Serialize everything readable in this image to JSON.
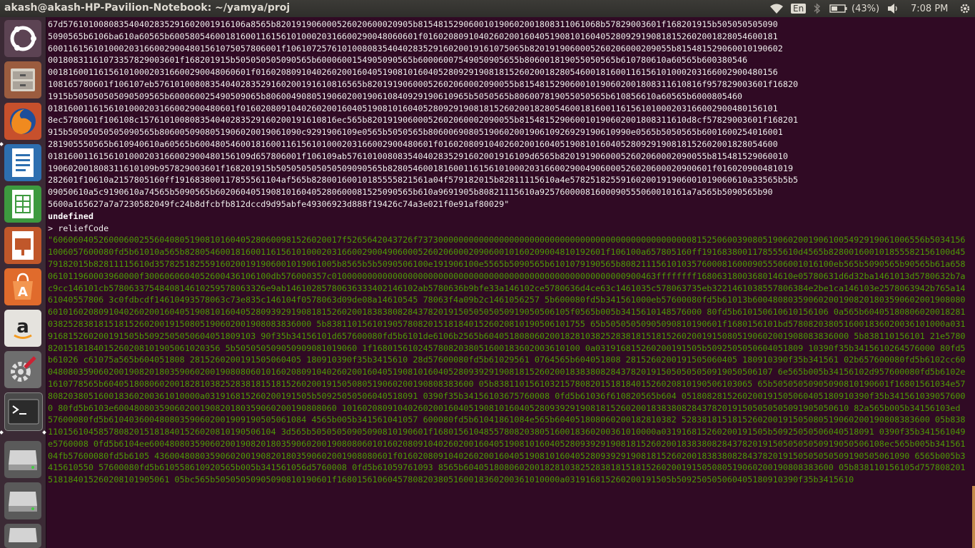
{
  "topbar": {
    "title": "akash@akash-HP-Pavilion-Notebook: ~/yamya/proj",
    "keyboard": "En",
    "battery": "(43%)",
    "time": "7:08 PM"
  },
  "launcher": {
    "icons": [
      "ubuntu-dash-icon",
      "files-icon",
      "firefox-icon",
      "writer-icon",
      "calc-icon",
      "impress-icon",
      "software-center-icon",
      "amazon-icon",
      "system-settings-icon",
      "terminal-icon",
      "drive-icon",
      "drive-icon",
      "drive-icon"
    ]
  },
  "terminal": {
    "hex_block": "67d576101008083540402835291602001916106a8565b820191906000526020600020905b815481529060010190602001808311061068b57829003601f168201915b505050505090\n5090565b6106ba610a60565b6005805460018160011615610100020316600290048060601f0160208091040260200160405190810160405280929190818152602001828054600181\n6001161561010002031660029004801561075057806001f10610725761010080835404028352916020019161075065b8201919060005260206000209055b815481529060010190602\n00180831161073357829003601f168201915b505050505090565b6000600154905090565b60006007549050905655b806001819055050565b610780610a60565b600380546\n0018160011615610100020316600290048060601f0160208091040260200160405190810160405280929190818152602001828054600181600116156101000203166002900480156\n108165780601f106107eb57610100808354040283529160200191610816565b82019190600052602060002090055b815481529060010190602001808311610816f957829003601f16820\n1915b505050505090509565b600060025490509065b8060049080519060200190610840929190610965b5050565b806007819055050565b610856610a60565b6000805460\n0181600116156101000203166002900480601f0160208091040260200160405190810160405280929190818152602001828054600181600116156101000203166002900480156101\n8ec5780601f106108c157610100808354040283529160200191610816ec565b82019190600052602060002090055b815481529060010190602001808311610d8cf57829003601f168201\n915b50505050505090565b8060050908051906020019061090c9291906109e0565b5050565b8060069080519060200190610926929190610990e0565b5050565b6001600254016001\n281905550565b610940610a60565b60048054600181600116156101000203166002900480601f0160208091040260200160405190810160405280929190818152602001828054600\n0181600116156101000203166002900480156109d657806001f106109ab576101008083540402835291602001916109d6565b82019190600052602060002090055b815481529060010\n190602001808311610109b957829003601f168201915b505050505050509090565b8280546001816001161561010002031660029004906000526020600020900601f016020900481019\n282601f10610a2157805160ff191683800117855561104af565b82800160010185555821561a04f579182015b82811115610a4e57825182559160200191906001019060610a33565b5b5\n09050610a5c9190610a74565b5090565b602060405190810160405280600081525090565b610a9691905b80821115610a92576000081600090555060010161a7a565b5090565b90\n5600a165627a7a7230582049fc24b8dfcbfb812dccd9d95abfe49306923d888f19426c74a3e021f0e91af80029\"",
    "undefined_text": "undefined",
    "prompt": "> reliefCode",
    "relief_string": "\"606060405260006002556040805190810160405280600981526020017f5265642043726f7373000000000000000000000000000000000000000000000000008152506003908051906020019061005492919061006556b50341561006057600080fd5b61010a565b82805460018160011615610100020316600290049060005260206000209060010160209004810192601f106100a657805160ff1916838001178555610d4565b828001600101855582156100d4579182015b82811115610d357825182559160200191906001019061005b8565b5b5090506100e191906100e5565b5090565b6101079190565b808211156101035760008160009055506001016100eb565b5090565b90565b61a658061011960003960000f3006060604052600436106100db576000357c0100000000000000000000000000000000000000000000000000000000900463ffffffff1680631800368014610e05780631d6d32ba1461013d5780632b7ac9cc146101cb5780633754840814610259578063326e9ab14610285780636333402146102ab5780636b9bfe33a146102ce5780636d4ce63c1461035c578063735eb3221461038557806384e2be1ca146103e2578063942b765a1461040557806 3c0fdbcdf14610493578063c73e835c146104f0578063d09de08a14610545 78063f4a09b2c1461056257 5b600080fd5b341561000eb57600080fd5b61013b6004808035906020019082018035906020019080806010160208091040260200160405190810160405280939291908181526020018383808284378201915050505050919050506105f0565b005b3415610148576000 80fd5b610150610610156106 0a565b604051808060200182810382528381815181526020019150805190602001908083836000 5b838110156101905780820151818401526020810190506101755 65b50505050905090810190601f1680156101bd5780820380516001836020036101000a031916815260200191505b5092505050604051809103 90f35b34156101d657600080fd5b6101de6106b2565b604051808060200182810382528381815181526020019150805190602001908083836000 5b838110156101 21e57808201518184015260208101905061020356 5b505050509050909081019060 1f16801561024578082038051600183602003610100 0a031916815260200191505b5092505050604051809 10390f35b3415610264576000 80fd5b61026 c61075a565b604051808 2815260200191505060405 180910390f35b3415610 28d57600080fd5b61029561 0764565b604051808 2815260200191505060405 180910390f35b341561 02b657600080fd5b6102cc6004808035906020019082018035906020019080806010160208091040260200160405190810160405280939291908181526020018383808284378201915050505050919050506107 6e565b005b34156102d957600080fd5b6102e1610778565b6040518080602001828103825283818151815260200191505080519060200190808383600 05b838110156103215780820151818401526020810190506103065 65b50505050905090810190601f16801561034e57808203805160018360200361010000a031916815260200191505b50925050506040518091 0390f35b34156103675760008 0fd5b61036f610820565b604 0518082815260200191505060405180910390f35b3415610390576000 80fd5b6103e60048080359060200190820180359060200190808060 1016020809104026020016040519081016040528093929190818152602001838380828437820191505050505091905050610 82a565b005b34156103ed 57600080fd5b610403600480803590602001909190505061084 4565b005b341561041057 600080fd5b61041861084e565b604051808060200182810382 5283818151815260200191505080519060200190808383600 05b838110156104585780820151818401526020810190506104 3d565b50505050905090810190601f16801561048557808203805160018360200361010000a031916815260200191505b50925050506040518091 0390f35b341561049e5760008 0fd5b6104ee6004808035906020019082018035906020019080806010160208091040260200160405190810160405280939291908181526020018383808284378201915050505050919050506108ec565b005b34156104fb57600080fd5b6105 43600480803590602001908201803590602001908080601f01602080910402602001604051908101604052809392919081815260200183838082843782019150505050509190505061090 6565b005b3415610550 57600080fd5b610558610920565b005b341561056d5760008 0fd5b61059761093 8565b6040518080602001828103825283818151815260200191505080519060200190808383600 05b838110156105d757808201518184015260208101905061 05bc565b50505050905090810190601f16801561060457808203805160018360200361010000a031916815260200191505b509250505060405180910390f35b3415610"
  }
}
